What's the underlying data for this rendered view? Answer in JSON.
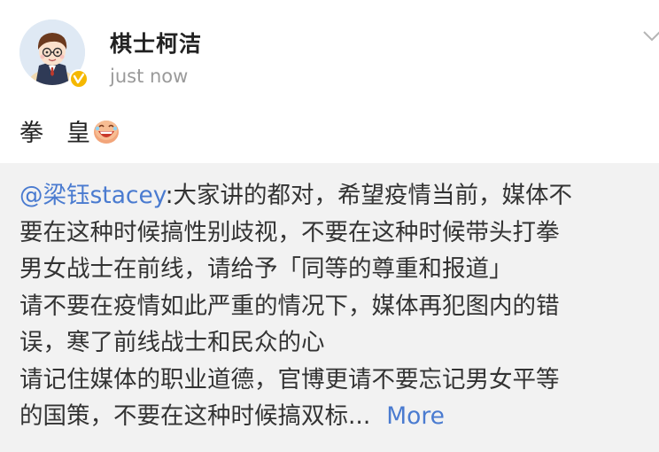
{
  "header": {
    "author_name": "棋士柯洁",
    "timestamp": "just now",
    "avatar_icon": "avatar-cartoon",
    "badge_icon": "verified-badge-icon",
    "chevron_icon": "chevron-down-icon"
  },
  "post": {
    "text_part1": "拳",
    "text_part2": "皇",
    "emoji_icon": "laughing-face-emoji-icon"
  },
  "repost": {
    "mention": "@梁钰stacey",
    "lines": [
      ":大家讲的都对，希望疫情当前，媒体不",
      "要在这种时候搞性别歧视，不要在这种时候带头打拳",
      "男女战士在前线，请给予「同等的尊重和报道」",
      "请不要在疫情如此严重的情况下，媒体再犯图内的错",
      "误，寒了前线战士和民众的心",
      "请记住媒体的职业道德，官博更请不要忘记男女平等",
      "的国策，不要在这种时候搞双标..."
    ],
    "more_label": "More"
  },
  "colors": {
    "link": "#4a7bd0",
    "badge": "#f5b800",
    "repost_bg": "#f2f2f2"
  }
}
